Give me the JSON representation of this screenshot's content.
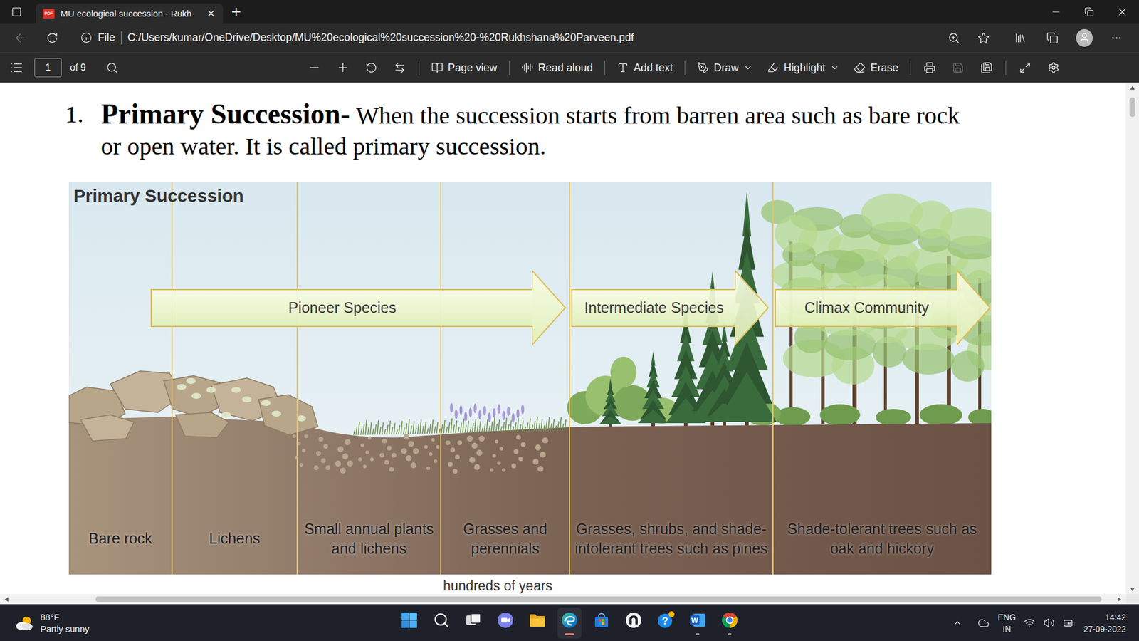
{
  "browser": {
    "tab": {
      "favicon": "PDF",
      "title": "MU ecological succession - Rukh",
      "close": "×",
      "selected": true
    },
    "new_tab": "+",
    "back": {
      "disabled": true
    },
    "address": {
      "scheme": "File",
      "url": "C:/Users/kumar/OneDrive/Desktop/MU%20ecological%20succession%20-%20Rukhshana%20Parveen.pdf"
    }
  },
  "pdf_toolbar": {
    "page": "1",
    "page_count": "of 9",
    "tools": [
      {
        "kind": "page-view",
        "label": "Page view",
        "dropdown": false
      },
      {
        "kind": "read-aloud",
        "label": "Read aloud",
        "dropdown": false
      },
      {
        "kind": "add-text",
        "label": "Add text",
        "dropdown": false
      },
      {
        "kind": "draw",
        "label": "Draw",
        "dropdown": true
      },
      {
        "kind": "highlight",
        "label": "Highlight",
        "dropdown": true
      },
      {
        "kind": "erase",
        "label": "Erase",
        "dropdown": false
      }
    ],
    "actions": [
      {
        "kind": "print",
        "disabled": false
      },
      {
        "kind": "save",
        "disabled": true
      },
      {
        "kind": "save-as",
        "disabled": false
      }
    ]
  },
  "document": {
    "heading": {
      "number": "1.",
      "term": "Primary Succession-",
      "text": "When the succession starts from barren area such as bare rock or open water. It is called primary succession."
    },
    "figure": {
      "title": "Primary Succession",
      "arrows": [
        {
          "label": "Pioneer Species"
        },
        {
          "label": "Intermediate Species"
        },
        {
          "label": "Climax Community"
        }
      ],
      "stages": [
        {
          "label": "Bare rock"
        },
        {
          "label": "Lichens"
        },
        {
          "label": "Small annual plants and lichens"
        },
        {
          "label": "Grasses and perennials"
        },
        {
          "label": "Grasses, shrubs, and shade-intolerant trees such as pines"
        },
        {
          "label": "Shade-tolerant trees such as oak and hickory"
        }
      ],
      "caption": "hundreds of years"
    }
  },
  "scrollbars": {
    "vertical": {
      "offset": 0.01,
      "size": 0.04
    },
    "horizontal": {
      "offset": 0.075,
      "size": 0.915
    }
  },
  "taskbar": {
    "weather": {
      "temp": "88°F",
      "condition": "Partly sunny"
    },
    "apps": [
      {
        "kind": "start",
        "label": "",
        "running": false,
        "active": false,
        "badge": false
      },
      {
        "kind": "search",
        "label": "",
        "running": false,
        "active": false,
        "badge": false
      },
      {
        "kind": "task-view",
        "label": "",
        "running": false,
        "active": false,
        "badge": false
      },
      {
        "kind": "chat",
        "label": "",
        "running": false,
        "active": false,
        "badge": false
      },
      {
        "kind": "explorer",
        "label": "",
        "running": false,
        "active": false,
        "badge": false
      },
      {
        "kind": "edge",
        "label": "",
        "running": true,
        "active": true,
        "badge": false
      },
      {
        "kind": "store",
        "label": "",
        "running": false,
        "active": false,
        "badge": false
      },
      {
        "kind": "app",
        "label": "",
        "running": false,
        "active": false,
        "badge": false
      },
      {
        "kind": "help",
        "label": "?",
        "running": false,
        "active": false,
        "badge": true
      },
      {
        "kind": "word",
        "label": "W",
        "running": true,
        "active": false,
        "badge": false
      },
      {
        "kind": "chrome",
        "label": "",
        "running": true,
        "active": false,
        "badge": false
      }
    ],
    "tray": {
      "language": "ENG",
      "region": "IN",
      "time": "14:42",
      "date": "27-09-2022"
    }
  }
}
